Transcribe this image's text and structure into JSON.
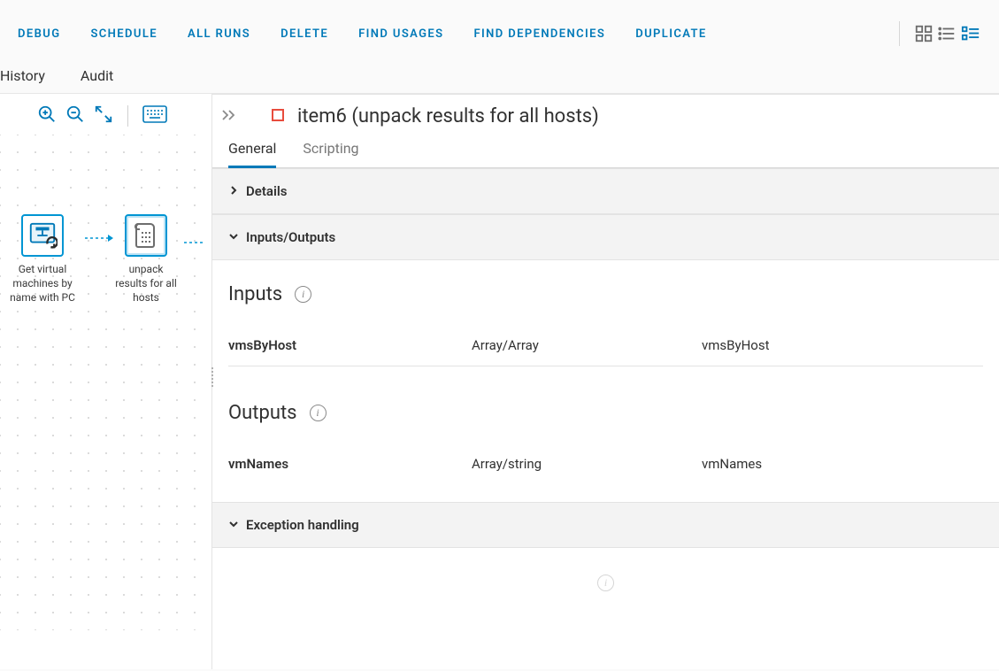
{
  "actions": {
    "debug": "DEBUG",
    "schedule": "SCHEDULE",
    "all_runs": "ALL RUNS",
    "delete": "DELETE",
    "find_usages": "FIND USAGES",
    "find_dependencies": "FIND DEPENDENCIES",
    "duplicate": "DUPLICATE"
  },
  "subtabs": {
    "history": "History",
    "audit": "Audit"
  },
  "canvas": {
    "node1_label": "Get virtual machines by name with PC",
    "node2_label": "unpack results for all hosts"
  },
  "detail": {
    "title": "item6 (unpack results for all hosts)",
    "tabs": {
      "general": "General",
      "scripting": "Scripting"
    },
    "sections": {
      "details": "Details",
      "io": "Inputs/Outputs",
      "exception": "Exception handling"
    },
    "inputs_title": "Inputs",
    "outputs_title": "Outputs",
    "inputs": [
      {
        "name": "vmsByHost",
        "type": "Array/Array",
        "binding": "vmsByHost"
      }
    ],
    "outputs": [
      {
        "name": "vmNames",
        "type": "Array/string",
        "binding": "vmNames"
      }
    ]
  }
}
